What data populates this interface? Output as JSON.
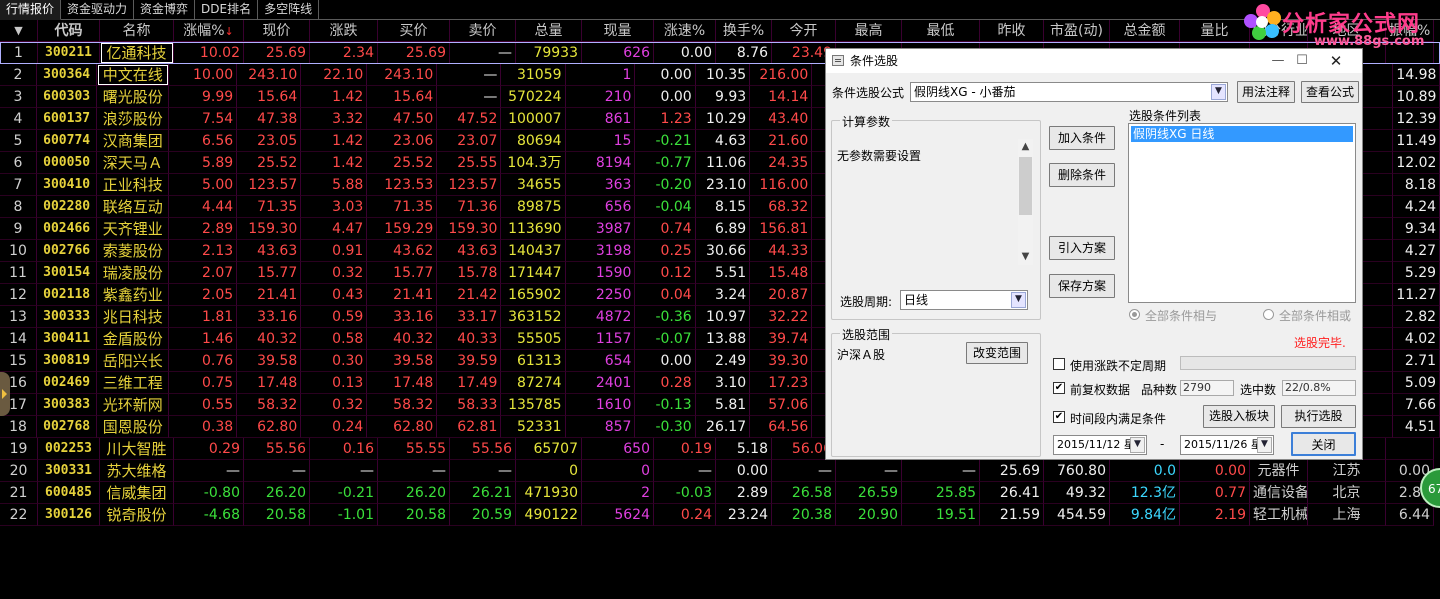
{
  "tabs": [
    "行情报价",
    "资金驱动力",
    "资金博弈",
    "DDE排名",
    "多空阵线"
  ],
  "columns": [
    "代码",
    "名称",
    "涨幅%",
    "现价",
    "涨跌",
    "买价",
    "卖价",
    "总量",
    "现量",
    "涨速%",
    "换手%",
    "今开",
    "最高",
    "最低",
    "昨收",
    "市盈(动)",
    "总金额",
    "量比",
    "细分行业",
    "地区",
    "振幅%"
  ],
  "rows": [
    {
      "n": "1",
      "code": "300211",
      "name": "亿通科技",
      "v": [
        "10.02",
        "25.69",
        "2.34",
        "25.69",
        "—",
        "79933",
        "626",
        "0.00",
        "8.76",
        "23.49"
      ]
    },
    {
      "n": "2",
      "code": "300364",
      "name": "中文在线",
      "v": [
        "10.00",
        "243.10",
        "22.10",
        "243.10",
        "—",
        "31059",
        "1",
        "0.00",
        "10.35",
        "216.00"
      ]
    },
    {
      "n": "3",
      "code": "600303",
      "name": "曙光股份",
      "v": [
        "9.99",
        "15.64",
        "1.42",
        "15.64",
        "—",
        "570224",
        "210",
        "0.00",
        "9.93",
        "14.14"
      ]
    },
    {
      "n": "4",
      "code": "600137",
      "name": "浪莎股份",
      "v": [
        "7.54",
        "47.38",
        "3.32",
        "47.50",
        "47.52",
        "100007",
        "861",
        "1.23",
        "10.29",
        "43.40"
      ]
    },
    {
      "n": "5",
      "code": "600774",
      "name": "汉商集团",
      "v": [
        "6.56",
        "23.05",
        "1.42",
        "23.06",
        "23.07",
        "80694",
        "15",
        "-0.21",
        "4.63",
        "21.60"
      ]
    },
    {
      "n": "6",
      "code": "000050",
      "name": "深天马Ａ",
      "v": [
        "5.89",
        "25.52",
        "1.42",
        "25.52",
        "25.55",
        "104.3万",
        "8194",
        "-0.77",
        "11.06",
        "24.35"
      ]
    },
    {
      "n": "7",
      "code": "300410",
      "name": "正业科技",
      "v": [
        "5.00",
        "123.57",
        "5.88",
        "123.53",
        "123.57",
        "34655",
        "363",
        "-0.20",
        "23.10",
        "116.00"
      ]
    },
    {
      "n": "8",
      "code": "002280",
      "name": "联络互动",
      "v": [
        "4.44",
        "71.35",
        "3.03",
        "71.35",
        "71.36",
        "89875",
        "656",
        "-0.04",
        "8.15",
        "68.32"
      ]
    },
    {
      "n": "9",
      "code": "002466",
      "name": "天齐锂业",
      "v": [
        "2.89",
        "159.30",
        "4.47",
        "159.29",
        "159.30",
        "113690",
        "3987",
        "0.74",
        "6.89",
        "156.81"
      ]
    },
    {
      "n": "10",
      "code": "002766",
      "name": "索菱股份",
      "v": [
        "2.13",
        "43.63",
        "0.91",
        "43.62",
        "43.63",
        "140437",
        "3198",
        "0.25",
        "30.66",
        "44.33"
      ]
    },
    {
      "n": "11",
      "code": "300154",
      "name": "瑞凌股份",
      "v": [
        "2.07",
        "15.77",
        "0.32",
        "15.77",
        "15.78",
        "171447",
        "1590",
        "0.12",
        "5.51",
        "15.48"
      ]
    },
    {
      "n": "12",
      "code": "002118",
      "name": "紫鑫药业",
      "v": [
        "2.05",
        "21.41",
        "0.43",
        "21.41",
        "21.42",
        "165902",
        "2250",
        "0.04",
        "3.24",
        "20.87"
      ]
    },
    {
      "n": "13",
      "code": "300333",
      "name": "兆日科技",
      "v": [
        "1.81",
        "33.16",
        "0.59",
        "33.16",
        "33.17",
        "363152",
        "4872",
        "-0.36",
        "10.97",
        "32.22"
      ]
    },
    {
      "n": "14",
      "code": "300411",
      "name": "金盾股份",
      "v": [
        "1.46",
        "40.32",
        "0.58",
        "40.32",
        "40.33",
        "55505",
        "1157",
        "-0.07",
        "13.88",
        "39.74"
      ]
    },
    {
      "n": "15",
      "code": "300819",
      "name": "岳阳兴长",
      "v": [
        "0.76",
        "39.58",
        "0.30",
        "39.58",
        "39.59",
        "61313",
        "654",
        "0.00",
        "2.49",
        "39.30"
      ]
    },
    {
      "n": "16",
      "code": "002469",
      "name": "三维工程",
      "v": [
        "0.75",
        "17.48",
        "0.13",
        "17.48",
        "17.49",
        "87274",
        "2401",
        "0.28",
        "3.10",
        "17.23"
      ]
    },
    {
      "n": "17",
      "code": "300383",
      "name": "光环新网",
      "v": [
        "0.55",
        "58.32",
        "0.32",
        "58.32",
        "58.33",
        "135785",
        "1610",
        "-0.13",
        "5.81",
        "57.06"
      ]
    },
    {
      "n": "18",
      "code": "002768",
      "name": "国恩股份",
      "v": [
        "0.38",
        "62.80",
        "0.24",
        "62.80",
        "62.81",
        "52331",
        "857",
        "-0.30",
        "26.17",
        "64.56"
      ]
    },
    {
      "n": "19",
      "code": "002253",
      "name": "川大智胜",
      "v": [
        "0.29",
        "55.56",
        "0.16",
        "55.55",
        "55.56",
        "65707",
        "650",
        "0.19",
        "5.18",
        "56.06"
      ]
    },
    {
      "n": "20",
      "code": "300331",
      "name": "苏大维格",
      "v": [
        "—",
        "—",
        "—",
        "—",
        "—",
        "0",
        "0",
        "—",
        "0.00",
        "—",
        "—",
        "—",
        "25.69",
        "760.80",
        "0.0",
        "0.00",
        "元器件",
        "江苏",
        "0.00"
      ]
    },
    {
      "n": "21",
      "code": "600485",
      "name": "信威集团",
      "v": [
        "-0.80",
        "26.20",
        "-0.21",
        "26.20",
        "26.21",
        "471930",
        "2",
        "-0.03",
        "2.89",
        "26.58",
        "26.59",
        "25.85",
        "26.41",
        "49.32",
        "12.3亿",
        "0.77",
        "通信设备",
        "北京",
        "2.80"
      ]
    },
    {
      "n": "22",
      "code": "300126",
      "name": "锐奇股份",
      "v": [
        "-4.68",
        "20.58",
        "-1.01",
        "20.58",
        "20.59",
        "490122",
        "5624",
        "0.24",
        "23.24",
        "20.38",
        "20.90",
        "19.51",
        "21.59",
        "454.59",
        "9.84亿",
        "2.19",
        "轻工机械",
        "上海",
        "6.44"
      ]
    }
  ],
  "right_column_values": [
    "12.72",
    "14.98",
    "10.89",
    "12.39",
    "11.49",
    "12.02",
    "8.18",
    "4.24",
    "9.34",
    "4.27",
    "5.29",
    "11.27",
    "2.82",
    "4.02",
    "2.71",
    "5.09",
    "7.66",
    "4.51"
  ],
  "dialog": {
    "title": "条件选股",
    "formula_label": "条件选股公式",
    "formula_value": "假阴线XG      - 小番茄",
    "btn_usage": "用法注释",
    "btn_view": "查看公式",
    "params_group": "计算参数",
    "params_text": "无参数需要设置",
    "period_label": "选股周期:",
    "period_value": "日线",
    "btn_add": "加入条件",
    "btn_delete": "删除条件",
    "btn_import": "引入方案",
    "btn_save": "保存方案",
    "cond_list_label": "选股条件列表",
    "cond_item": "假阴线XG  日线",
    "radio_and": "全部条件相与",
    "radio_or": "全部条件相或",
    "range_group": "选股范围",
    "range_value": "沪深Ａ股",
    "btn_change_range": "改变范围",
    "status": "选股完毕.",
    "chk_period": "使用涨跌不定周期",
    "chk_fuquan": "前复权数据",
    "count_label": "品种数",
    "count_value": "2790",
    "selected_label": "选中数",
    "selected_value": "22/0.8%",
    "chk_timerange": "时间段内满足条件",
    "btn_to_block": "选股入板块",
    "btn_execute": "执行选股",
    "btn_close": "关闭",
    "date_from": "2015/11/12 星",
    "date_to": "2015/11/26 星",
    "date_sep": "-"
  },
  "logo": {
    "text": "分析家公式网",
    "url": "www.88gs.com"
  },
  "badge": "67"
}
